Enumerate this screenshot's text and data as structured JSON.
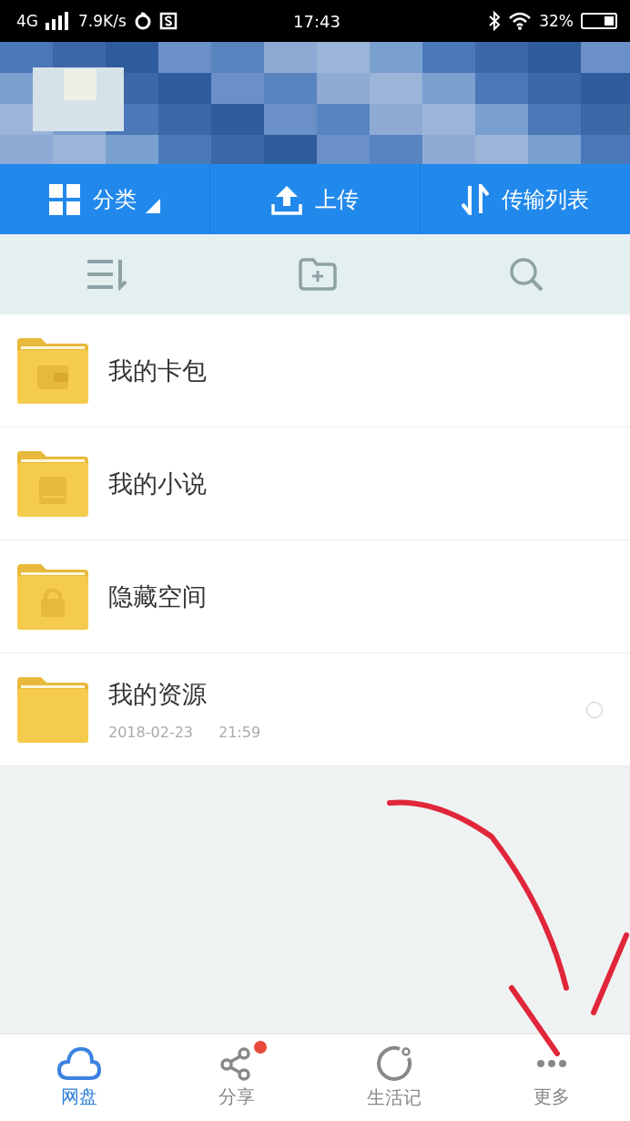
{
  "status_bar": {
    "network": "4G",
    "speed": "7.9K/s",
    "time": "17:43",
    "battery": "32%"
  },
  "action_bar": [
    {
      "kind": "category",
      "label": "分类"
    },
    {
      "kind": "upload",
      "label": "上传"
    },
    {
      "kind": "transfer",
      "label": "传输列表"
    }
  ],
  "files": [
    {
      "kind": "wallet",
      "name": "我的卡包"
    },
    {
      "kind": "book",
      "name": "我的小说"
    },
    {
      "kind": "lock",
      "name": "隐藏空间"
    },
    {
      "kind": "plain",
      "name": "我的资源",
      "date": "2018-02-23",
      "time": "21:59",
      "selected": false
    }
  ],
  "tabs": [
    {
      "kind": "cloud",
      "label": "网盘",
      "selected": true,
      "badge": false
    },
    {
      "kind": "share",
      "label": "分享",
      "selected": false,
      "badge": true
    },
    {
      "kind": "life",
      "label": "生活记",
      "selected": false,
      "badge": false
    },
    {
      "kind": "more",
      "label": "更多",
      "selected": false,
      "badge": false
    }
  ]
}
